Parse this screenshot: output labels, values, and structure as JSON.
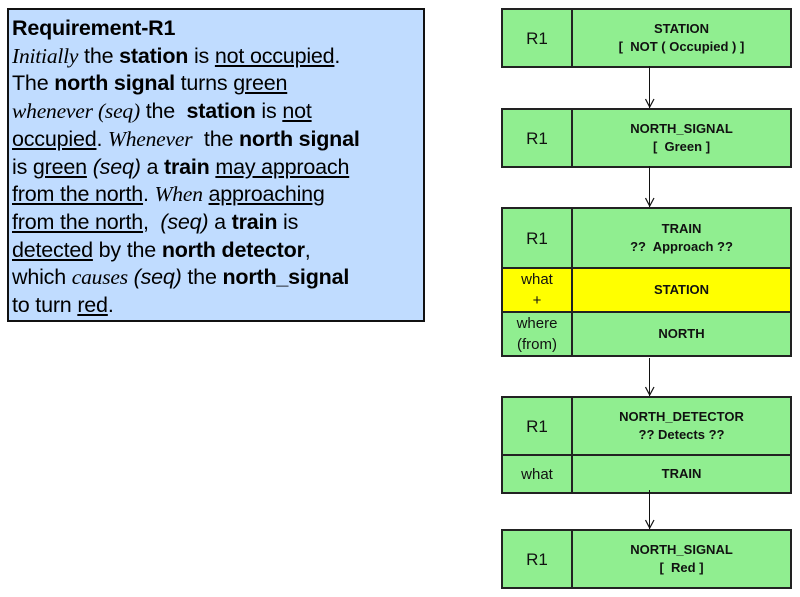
{
  "requirement": {
    "title": "Requirement-R1",
    "lines": [
      [
        {
          "t": "Initially",
          "s": "i"
        },
        {
          "t": " the ",
          "s": ""
        },
        {
          "t": "station",
          "s": "b"
        },
        {
          "t": " is ",
          "s": ""
        },
        {
          "t": "not occupied",
          "s": "u"
        },
        {
          "t": ".",
          "s": ""
        }
      ],
      [
        {
          "t": "The ",
          "s": ""
        },
        {
          "t": "north signal",
          "s": "b"
        },
        {
          "t": " turns ",
          "s": ""
        },
        {
          "t": "green",
          "s": "u"
        }
      ],
      [
        {
          "t": "whenever (seq)",
          "s": "i"
        },
        {
          "t": " the  ",
          "s": ""
        },
        {
          "t": "station",
          "s": "b"
        },
        {
          "t": " is ",
          "s": ""
        },
        {
          "t": "not",
          "s": "u"
        }
      ],
      [
        {
          "t": "occupied",
          "s": "u"
        },
        {
          "t": ". ",
          "s": ""
        },
        {
          "t": "Whenever",
          "s": "i"
        },
        {
          "t": "  the ",
          "s": ""
        },
        {
          "t": "north signal",
          "s": "b"
        }
      ],
      [
        {
          "t": "is ",
          "s": ""
        },
        {
          "t": "green",
          "s": "u"
        },
        {
          "t": " ",
          "s": ""
        },
        {
          "t": "(seq)",
          "s": "is"
        },
        {
          "t": " a ",
          "s": ""
        },
        {
          "t": "train",
          "s": "b"
        },
        {
          "t": " ",
          "s": ""
        },
        {
          "t": "may approach",
          "s": "u"
        }
      ],
      [
        {
          "t": "from the north",
          "s": "u"
        },
        {
          "t": ". ",
          "s": ""
        },
        {
          "t": "When",
          "s": "i"
        },
        {
          "t": " ",
          "s": ""
        },
        {
          "t": "approaching",
          "s": "u"
        }
      ],
      [
        {
          "t": "from the north",
          "s": "u"
        },
        {
          "t": ",  ",
          "s": ""
        },
        {
          "t": "(seq)",
          "s": "is"
        },
        {
          "t": " a ",
          "s": ""
        },
        {
          "t": "train",
          "s": "b"
        },
        {
          "t": " is",
          "s": ""
        }
      ],
      [
        {
          "t": "detected",
          "s": "u"
        },
        {
          "t": " by the ",
          "s": ""
        },
        {
          "t": "north detector",
          "s": "b"
        },
        {
          "t": ",",
          "s": ""
        }
      ],
      [
        {
          "t": "which ",
          "s": ""
        },
        {
          "t": "causes",
          "s": "i"
        },
        {
          "t": " ",
          "s": ""
        },
        {
          "t": "(seq)",
          "s": "is"
        },
        {
          "t": " the ",
          "s": ""
        },
        {
          "t": "north_signal",
          "s": "b"
        }
      ],
      [
        {
          "t": "to turn ",
          "s": ""
        },
        {
          "t": "red",
          "s": "u"
        },
        {
          "t": ".",
          "s": ""
        }
      ]
    ]
  },
  "colors": {
    "req_bg": "#c0dcff",
    "node_bg": "#90ee90",
    "highlight_bg": "#ffff00"
  },
  "flow": [
    {
      "rows": [
        {
          "left": "R1",
          "right": [
            "STATION",
            "[  NOT ( Occupied ) ]"
          ]
        }
      ]
    },
    {
      "rows": [
        {
          "left": "R1",
          "right": [
            "NORTH_SIGNAL",
            "[  Green ]"
          ]
        }
      ]
    },
    {
      "rows": [
        {
          "left": "R1",
          "right": [
            "TRAIN",
            "??  Approach ??"
          ]
        },
        {
          "left": "what\n+",
          "right": [
            "STATION"
          ],
          "highlight": true
        },
        {
          "left": "where\n(from)",
          "right": [
            "NORTH"
          ]
        }
      ]
    },
    {
      "rows": [
        {
          "left": "R1",
          "right": [
            "NORTH_DETECTOR",
            "?? Detects ??"
          ]
        },
        {
          "left": "what",
          "right": [
            "TRAIN"
          ]
        }
      ]
    },
    {
      "rows": [
        {
          "left": "R1",
          "right": [
            "NORTH_SIGNAL",
            "[  Red ]"
          ]
        }
      ]
    }
  ]
}
